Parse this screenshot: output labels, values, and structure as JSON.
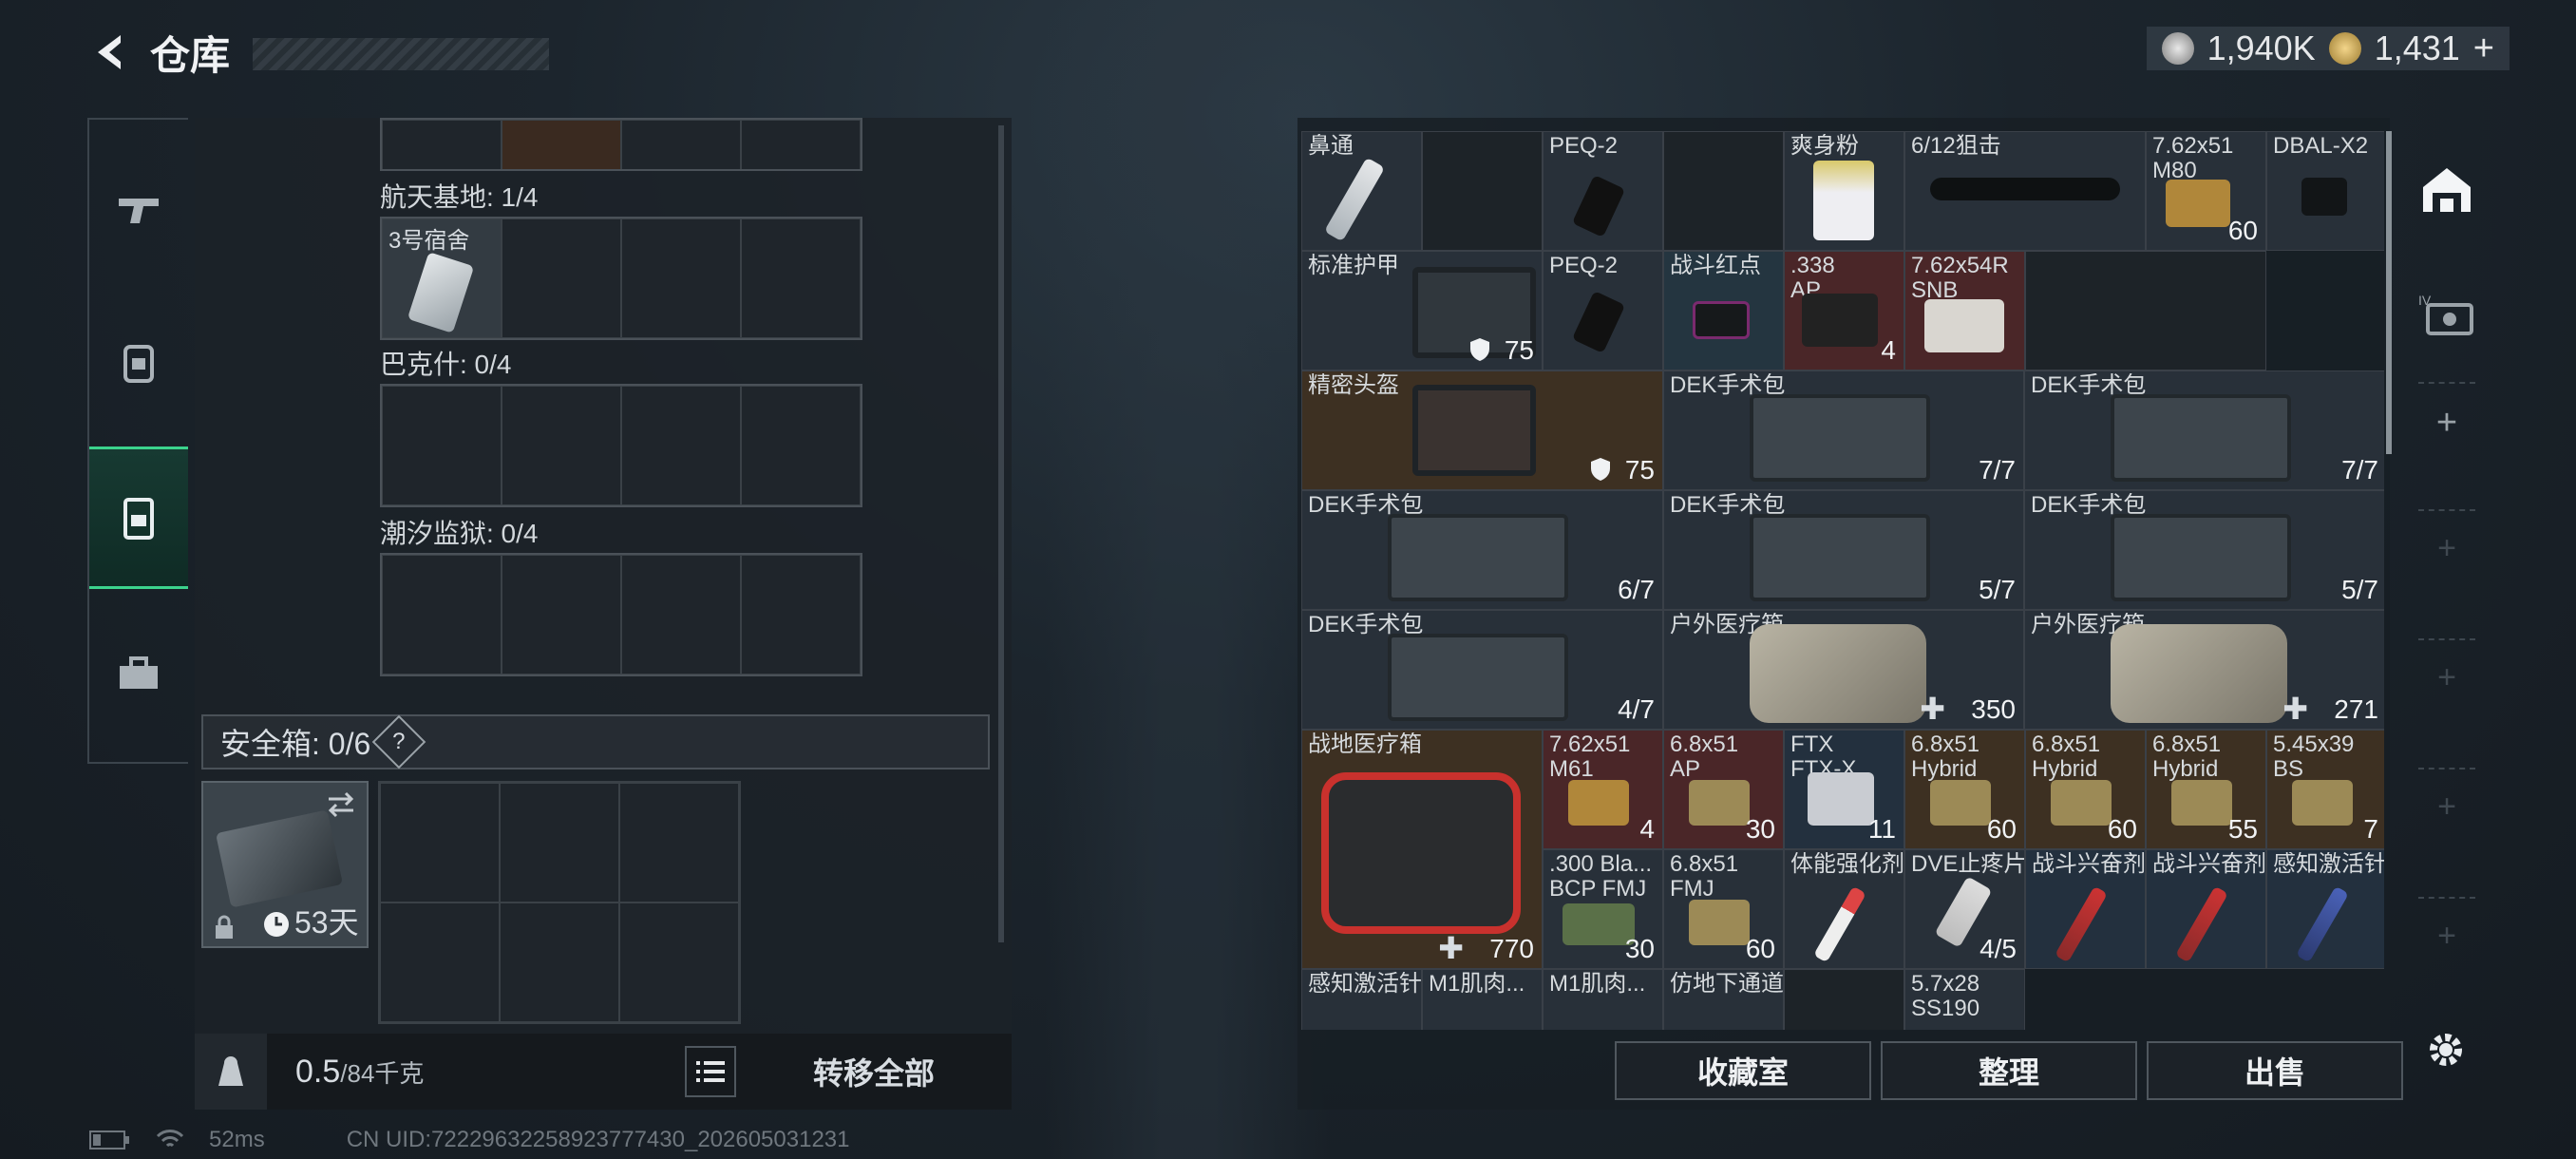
{
  "header": {
    "title": "仓库"
  },
  "currency": {
    "silver": "1,940K",
    "gold": "1,431",
    "add": "+"
  },
  "left": {
    "sections": [
      {
        "label": "航天基地: 1/4",
        "item": "3号宿舍"
      },
      {
        "label": "巴克什: 0/4"
      },
      {
        "label": "潮汐监狱: 0/4"
      }
    ],
    "safebox": {
      "label": "安全箱: 0/6",
      "help": "?",
      "days": "53天"
    },
    "weight": {
      "value": "0.5",
      "max": "/84千克"
    },
    "transfer_all": "转移全部"
  },
  "items": [
    {
      "name": "鼻通",
      "value": ""
    },
    {
      "name": "PEQ-2",
      "value": ""
    },
    {
      "name": "爽身粉",
      "value": ""
    },
    {
      "name": "6/12狙击",
      "value": ""
    },
    {
      "name": "7.62x51\nM80",
      "value": "60"
    },
    {
      "name": "DBAL-X2",
      "value": ""
    },
    {
      "name": "标准护甲",
      "value": "75"
    },
    {
      "name": "PEQ-2",
      "value": ""
    },
    {
      "name": "战斗红点",
      "value": ""
    },
    {
      "name": ".338\nAP",
      "value": "4"
    },
    {
      "name": "7.62x54R\nSNB",
      "value": ""
    },
    {
      "name": "精密头盔",
      "value": "75"
    },
    {
      "name": "DEK手术包",
      "value": "7/7"
    },
    {
      "name": "DEK手术包",
      "value": "7/7"
    },
    {
      "name": "DEK手术包",
      "value": "6/7"
    },
    {
      "name": "DEK手术包",
      "value": "5/7"
    },
    {
      "name": "DEK手术包",
      "value": "5/7"
    },
    {
      "name": "DEK手术包",
      "value": "4/7"
    },
    {
      "name": "户外医疗箱",
      "value": "350"
    },
    {
      "name": "户外医疗箱",
      "value": "271"
    },
    {
      "name": "战地医疗箱",
      "value": "770"
    },
    {
      "name": "7.62x51\nM61",
      "value": "4"
    },
    {
      "name": "6.8x51\nAP",
      "value": "30"
    },
    {
      "name": "FTX\nFTX-X",
      "value": "11"
    },
    {
      "name": "6.8x51\nHybrid",
      "value": "60"
    },
    {
      "name": "6.8x51\nHybrid",
      "value": "60"
    },
    {
      "name": "6.8x51\nHybrid",
      "value": "55"
    },
    {
      "name": "5.45x39\nBS",
      "value": "7"
    },
    {
      "name": ".300 Bla...\nBCP FMJ",
      "value": "30"
    },
    {
      "name": "6.8x51\nFMJ",
      "value": "60"
    },
    {
      "name": "体能强化剂",
      "value": ""
    },
    {
      "name": "DVE止疼片",
      "value": "4/5"
    },
    {
      "name": "战斗兴奋剂",
      "value": ""
    },
    {
      "name": "战斗兴奋剂",
      "value": ""
    },
    {
      "name": "感知激活针",
      "value": ""
    },
    {
      "name": "感知激活针",
      "value": ""
    },
    {
      "name": "M1肌肉...",
      "value": ""
    },
    {
      "name": "M1肌肉...",
      "value": ""
    },
    {
      "name": "仿地下通道",
      "value": ""
    },
    {
      "name": "5.7x28\nSS190",
      "value": ""
    }
  ],
  "buttons": {
    "collection": "收藏室",
    "sort": "整理",
    "sell": "出售"
  },
  "status": {
    "ping": "52ms",
    "uid": "CN UID:72229632258923777430_202605031231"
  },
  "colors": {
    "accent": "#3bd38d"
  }
}
